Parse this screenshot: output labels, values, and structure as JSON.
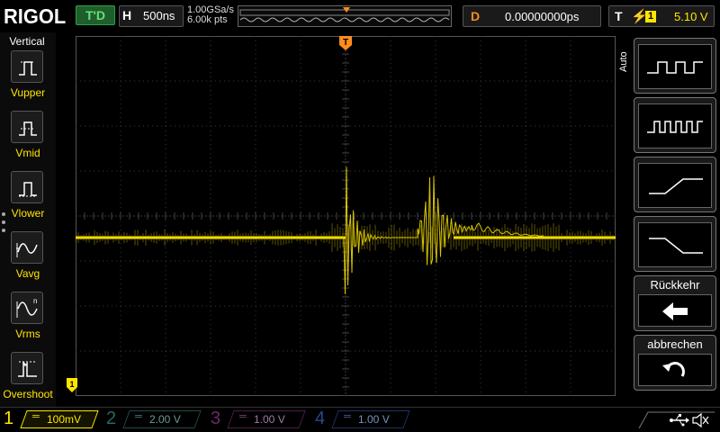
{
  "brand": "RIGOL",
  "run_state": "T'D",
  "horizontal": {
    "key": "H",
    "timebase": "500ns",
    "sample_rate": "1.00GSa/s",
    "memory_depth": "6.00k pts"
  },
  "delay": {
    "key": "D",
    "value": "0.00000000ps"
  },
  "trigger": {
    "key": "T",
    "edge_icon": "rising-edge-icon",
    "source": "1",
    "level": "5.10 V"
  },
  "left_menu": {
    "title": "Vertical",
    "items": [
      {
        "label": "Vupper",
        "icon": "vupper-icon"
      },
      {
        "label": "Vmid",
        "icon": "vmid-icon"
      },
      {
        "label": "Vlower",
        "icon": "vlower-icon"
      },
      {
        "label": "Vavg",
        "icon": "vavg-icon"
      },
      {
        "label": "Vrms",
        "icon": "vrms-icon"
      },
      {
        "label": "Overshoot",
        "icon": "overshoot-icon"
      }
    ]
  },
  "markers": {
    "trigger_position": "T",
    "trigger_level": "T",
    "channel1_ground": "1"
  },
  "right_menu": {
    "mode": "Auto",
    "buttons": [
      {
        "icon": "pulse-wide-icon"
      },
      {
        "icon": "pulse-narrow-icon"
      },
      {
        "icon": "rising-ramp-icon"
      },
      {
        "icon": "falling-ramp-icon"
      }
    ],
    "back": {
      "label": "Rückkehr",
      "icon": "back-arrow-icon"
    },
    "cancel": {
      "label": "abbrechen",
      "icon": "undo-icon"
    }
  },
  "channels": [
    {
      "num": "1",
      "scale": "100mV",
      "color": "#ffe600",
      "active": true
    },
    {
      "num": "2",
      "scale": "2.00 V",
      "color": "#00c0c0",
      "active": false
    },
    {
      "num": "3",
      "scale": "1.00 V",
      "color": "#d040d0",
      "active": false
    },
    {
      "num": "4",
      "scale": "1.00 V",
      "color": "#2f7fff",
      "active": false
    }
  ],
  "status_icons": [
    "usb-icon",
    "mute-icon"
  ]
}
